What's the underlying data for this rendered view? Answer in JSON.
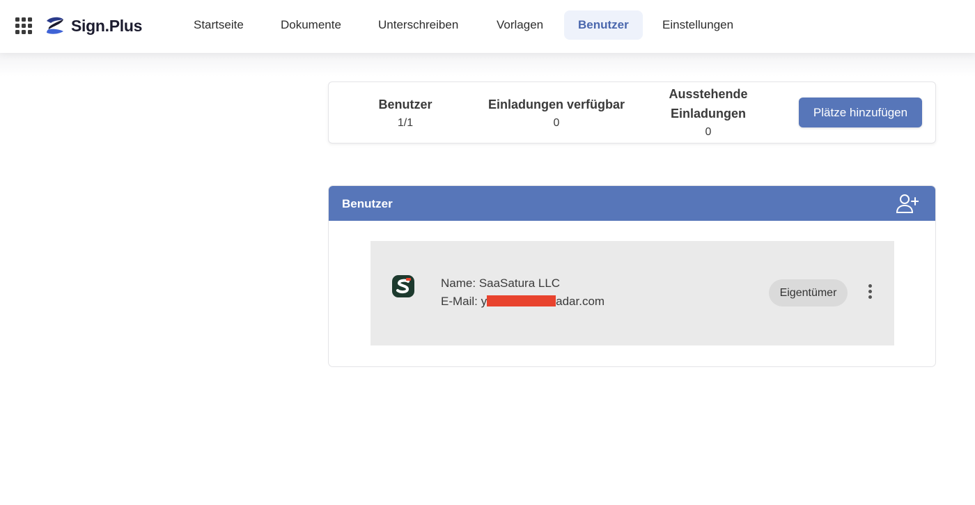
{
  "app": {
    "brand_name": "Sign.Plus",
    "brand_color": "#1b1b2e",
    "accent_color": "#5776b9"
  },
  "nav": {
    "tabs": [
      {
        "label": "Startseite",
        "active": false
      },
      {
        "label": "Dokumente",
        "active": false
      },
      {
        "label": "Unterschreiben",
        "active": false
      },
      {
        "label": "Vorlagen",
        "active": false
      },
      {
        "label": "Benutzer",
        "active": true
      },
      {
        "label": "Einstellungen",
        "active": false
      }
    ]
  },
  "stats": {
    "users_label": "Benutzer",
    "users_value": "1/1",
    "invites_available_label": "Einladungen verfügbar",
    "invites_available_value": "0",
    "pending_invites_label_line1": "Ausstehende",
    "pending_invites_label_line2": "Einladungen",
    "pending_invites_value": "0",
    "add_seats_label": "Plätze hinzufügen"
  },
  "users_panel": {
    "title": "Benutzer",
    "add_user_icon": "add-user-icon",
    "users": [
      {
        "name_prefix": "Name:",
        "name": "SaaSatura LLC",
        "email_prefix": "E-Mail:",
        "email_start": "y",
        "email_end": "adar.com",
        "role": "Eigentümer",
        "avatar_icon": "saasatura-logo"
      }
    ]
  }
}
